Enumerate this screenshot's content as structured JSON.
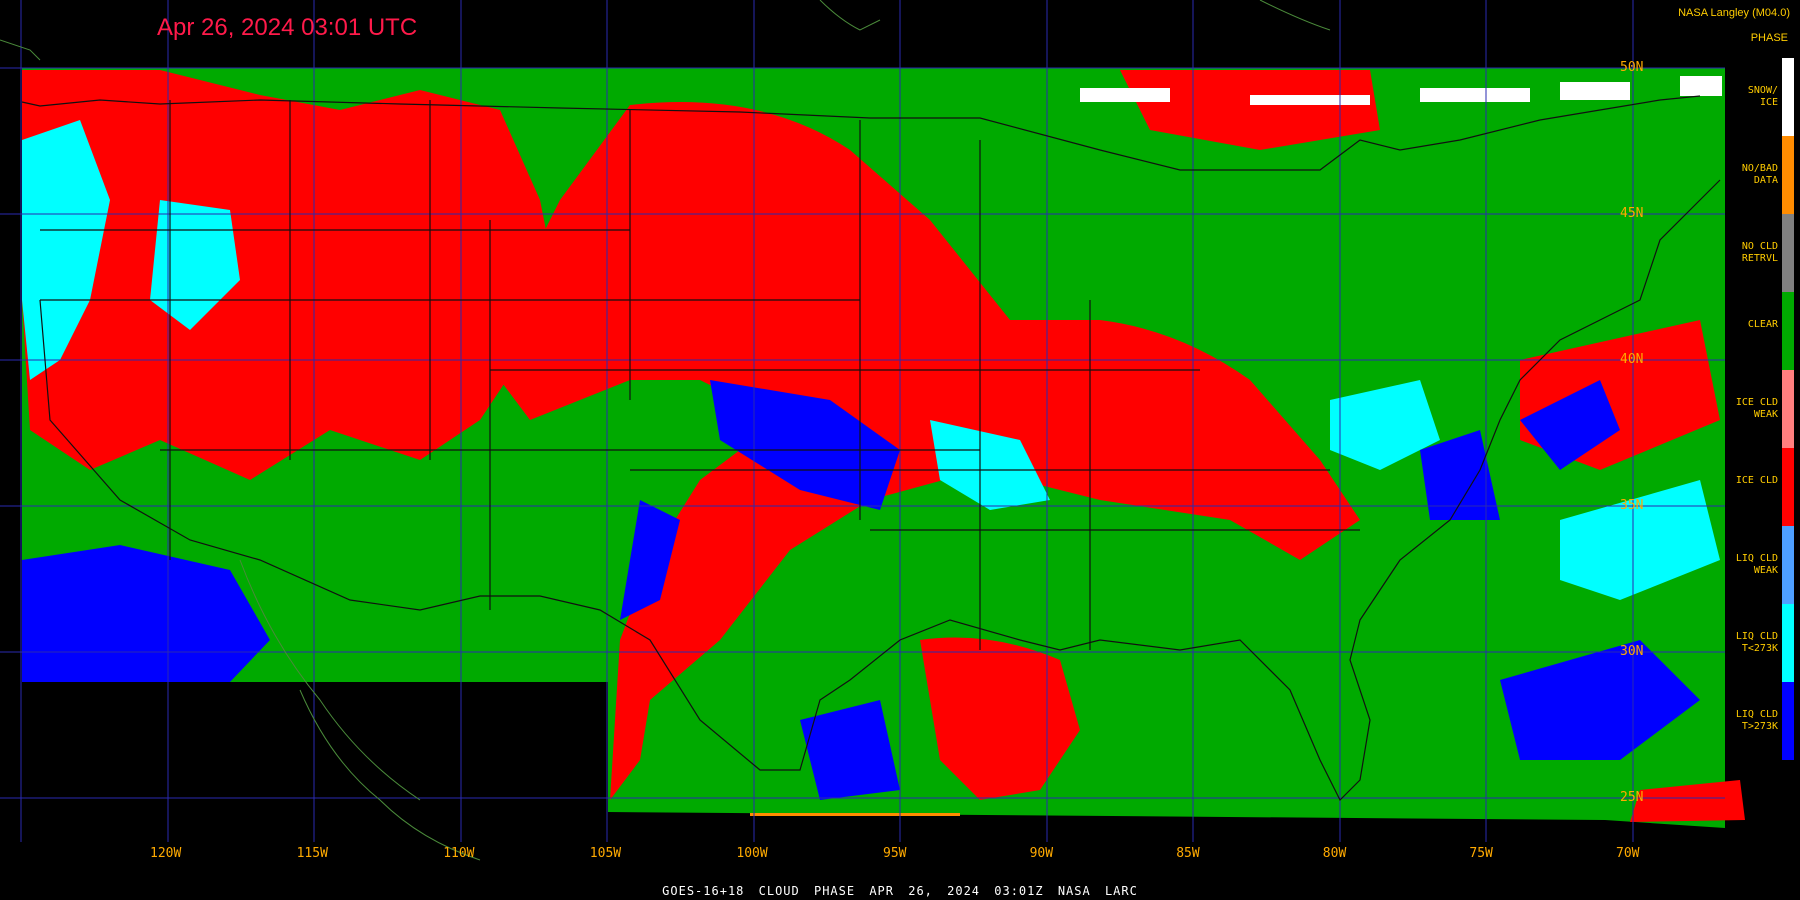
{
  "header": {
    "title": "Apr 26, 2024 03:01 UTC",
    "credit": "NASA Langley (M04.0)"
  },
  "legend": {
    "title": "PHASE",
    "items": [
      {
        "label": "SNOW/\nICE",
        "color": "#ffffff"
      },
      {
        "label": "NO/BAD\nDATA",
        "color": "#ff8c00"
      },
      {
        "label": "NO CLD\nRETRVL",
        "color": "#808080"
      },
      {
        "label": "CLEAR",
        "color": "#00aa00"
      },
      {
        "label": "ICE CLD\nWEAK",
        "color": "#ff7f7f"
      },
      {
        "label": "ICE CLD",
        "color": "#ff0000"
      },
      {
        "label": "LIQ CLD\nWEAK",
        "color": "#4d9fff"
      },
      {
        "label": "LIQ CLD\nT<273K",
        "color": "#00ffff"
      },
      {
        "label": "LIQ CLD\nT>273K",
        "color": "#0000ff"
      }
    ]
  },
  "longitudes": [
    "120W",
    "115W",
    "110W",
    "105W",
    "100W",
    "95W",
    "90W",
    "85W",
    "80W",
    "75W",
    "70W"
  ],
  "latitudes": [
    "50N",
    "45N",
    "40N",
    "35N",
    "30N",
    "25N"
  ],
  "footer": "GOES-16+18  CLOUD PHASE  APR 26, 2024 03:01Z  NASA LARC"
}
